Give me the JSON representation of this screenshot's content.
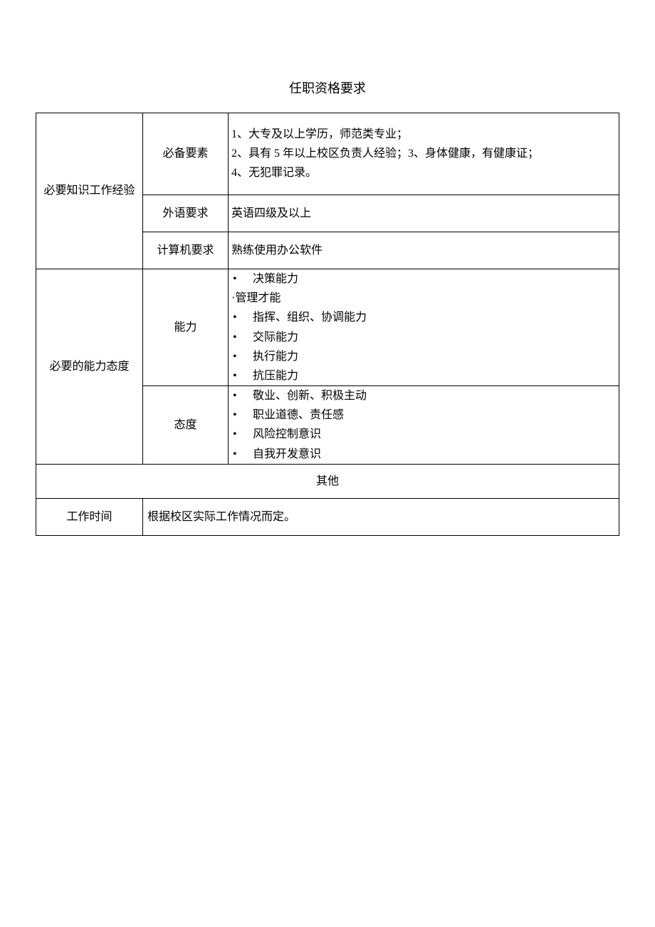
{
  "title": "任职资格要求",
  "rows": {
    "knowledge": {
      "header": "必要知识工作经验",
      "essential": {
        "label": "必备要素",
        "lines": [
          "1、大专及以上学历，师范类专业；",
          "2、具有 5 年以上校区负责人经验；3、身体健康，有健康证；",
          "4、无犯罪记录。"
        ]
      },
      "language": {
        "label": "外语要求",
        "value": "英语四级及以上"
      },
      "computer": {
        "label": "计算机要求",
        "value": "熟练使用办公软件"
      }
    },
    "ability_attitude": {
      "header": "必要的能力态度",
      "ability": {
        "label": "能力",
        "group_intro": "·管理才能",
        "items": [
          "决策能力",
          "指挥、组织、协调能力",
          "交际能力",
          "执行能力",
          "抗压能力"
        ]
      },
      "attitude": {
        "label": "态度",
        "items": [
          "敬业、创新、积极主动",
          "职业道德、责任感",
          "风险控制意识",
          "自我开发意识"
        ]
      }
    },
    "other": {
      "header": "其他",
      "worktime": {
        "label": "工作时间",
        "value": "根据校区实际工作情况而定。"
      }
    }
  }
}
